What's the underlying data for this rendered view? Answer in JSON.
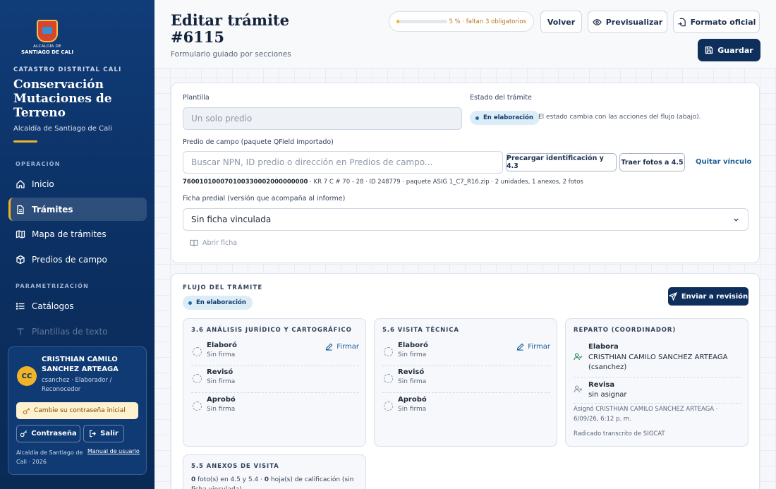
{
  "app": {
    "logo_line1": "ALCALDÍA DE",
    "logo_line2": "SANTIAGO DE CALI",
    "kicker": "CATASTRO DISTRITAL CALI",
    "title": "Conservación Mutaciones de Terreno",
    "subtitle": "Alcaldía de Santiago de Cali"
  },
  "sidebar": {
    "section_operacion": "OPERACIÓN",
    "section_param": "PARAMETRIZACIÓN",
    "items": [
      {
        "label": "Inicio",
        "icon": "home-icon"
      },
      {
        "label": "Trámites",
        "icon": "document-icon",
        "active": true
      },
      {
        "label": "Mapa de trámites",
        "icon": "map-icon"
      },
      {
        "label": "Predios de campo",
        "icon": "cube-icon"
      },
      {
        "label": "Catálogos",
        "icon": "list-icon"
      },
      {
        "label": "Plantillas de texto",
        "icon": "text-icon"
      }
    ]
  },
  "user": {
    "initials": "CC",
    "name": "CRISTHIAN CAMILO SANCHEZ ARTEAGA",
    "role": "csanchez · Elaborador / Reconocedor",
    "password_notice": "Cambie su contraseña inicial",
    "password_button": "Contraseña",
    "logout_button": "Salir",
    "footer": "Alcaldía de Santiago de Cali · 2026",
    "manual_link": "Manual de usuario"
  },
  "header": {
    "title": "Editar trámite #6115",
    "subtitle": "Formulario guiado por secciones",
    "progress_text": "5 % · faltan 3 obligatorios",
    "progress_percent": 5,
    "back_button": "Volver",
    "preview_button": "Previsualizar",
    "official_button": "Formato oficial",
    "save_button": "Guardar"
  },
  "form": {
    "template_label": "Plantilla",
    "template_value": "Un solo predio",
    "status_label": "Estado del trámite",
    "status_badge": "En elaboración",
    "status_note": "El estado cambia con las acciones del flujo (abajo).",
    "field_label": "Predio de campo (paquete QField importado)",
    "field_placeholder": "Buscar NPN, ID predio o dirección en Predios de campo...",
    "preload_button": "Precargar identificación y 4.3",
    "photos_button": "Traer fotos a 4.5",
    "unlink_link": "Quitar vínculo",
    "linked_npn": "760010100070100330002000000000",
    "linked_meta": " · KR 7 C # 70 - 28 · ID 248779 · paquete ASIG 1_C7_R16.zip · 2 unidades, 1 anexos, 2 fotos",
    "ficha_label": "Ficha predial (versión que acompaña al informe)",
    "ficha_value": "Sin ficha vinculada",
    "open_ficha": "Abrir ficha"
  },
  "flow": {
    "kicker": "FLUJO DEL TRÁMITE",
    "badge": "En elaboración",
    "send_button": "Enviar a revisión",
    "blocks": [
      {
        "title": "3.6 ANÁLISIS JURÍDICO Y CARTOGRÁFICO",
        "firmar": "Firmar",
        "rows": [
          {
            "role": "Elaboró",
            "status": "Sin firma"
          },
          {
            "role": "Revisó",
            "status": "Sin firma"
          },
          {
            "role": "Aprobó",
            "status": "Sin firma"
          }
        ]
      },
      {
        "title": "5.6 VISITA TÉCNICA",
        "firmar": "Firmar",
        "rows": [
          {
            "role": "Elaboró",
            "status": "Sin firma"
          },
          {
            "role": "Revisó",
            "status": "Sin firma"
          },
          {
            "role": "Aprobó",
            "status": "Sin firma"
          }
        ]
      }
    ],
    "reparto": {
      "title": "REPARTO (COORDINADOR)",
      "elabora_label": "Elabora",
      "elabora_value": "CRISTHIAN CAMILO SANCHEZ ARTEAGA (csanchez)",
      "revisa_label": "Revisa",
      "revisa_value": "sin asignar",
      "assigned_note": "Asignó CRISTHIAN CAMILO SANCHEZ ARTEAGA · 6/09/26, 6:12 p. m.",
      "radicado_note": "Radicado transcrito de SIGCAT"
    },
    "anexos": {
      "title": "5.5 ANEXOS DE VISITA",
      "photos_count": "0",
      "text_a": " foto(s) en 4.5 y 5.4 · ",
      "sheets_count": "0",
      "text_b": " hoja(s) de calificación (sin ficha vinculada)"
    }
  }
}
